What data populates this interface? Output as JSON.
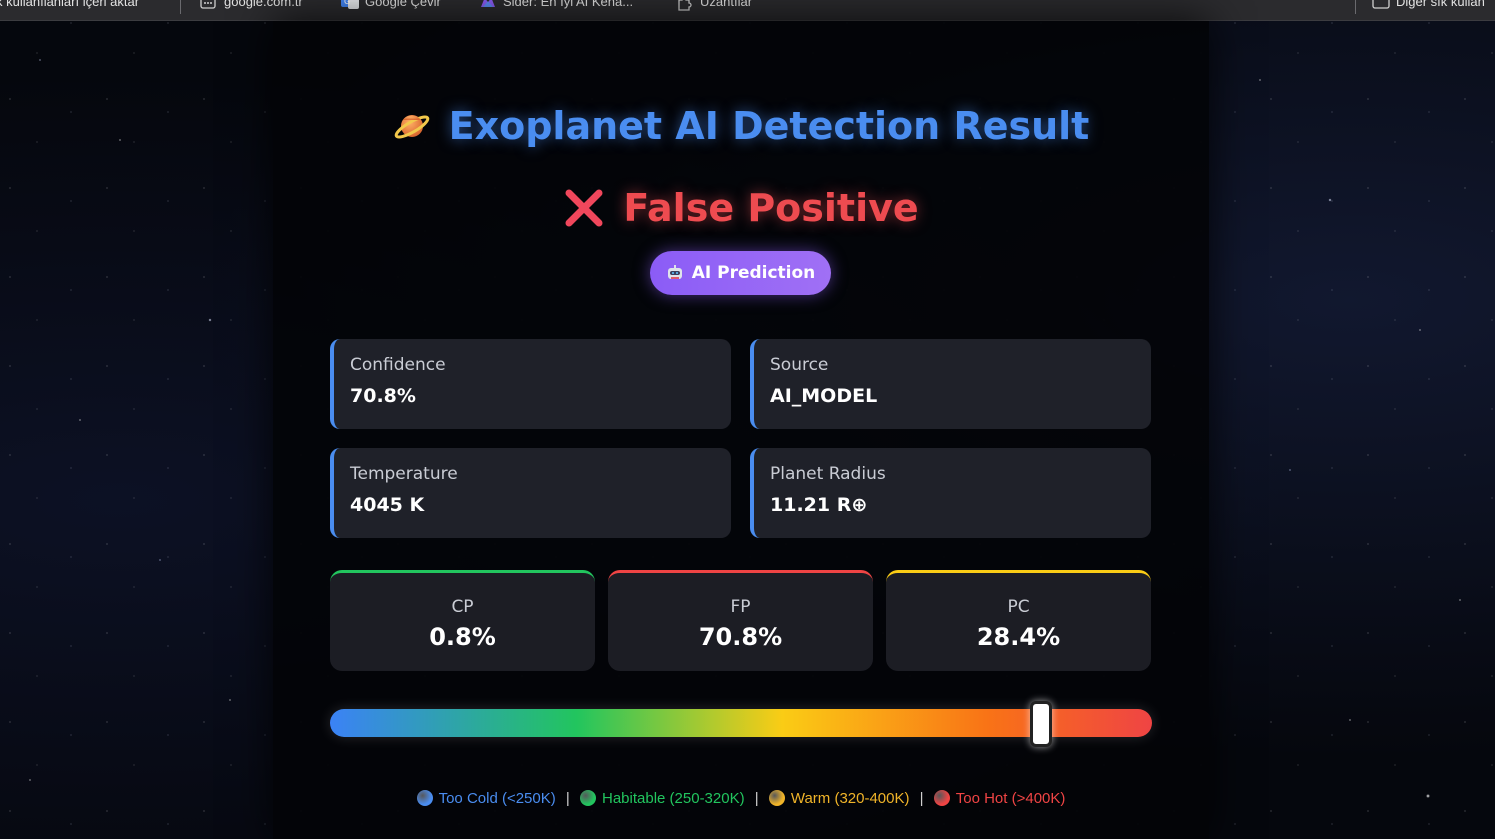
{
  "bookmarks_bar": {
    "items": [
      {
        "label": "k kullanılanları içeri aktar",
        "icon": "none"
      },
      {
        "label": "google.com.tr",
        "icon": "grid-icon"
      },
      {
        "label": "Google Çevir",
        "icon": "translate-icon"
      },
      {
        "label": "Sider: En İyi AI Kena...",
        "icon": "sider-icon"
      },
      {
        "label": "Uzantılar",
        "icon": "puzzle-icon"
      }
    ],
    "other_bookmarks": "Diğer sık kullan"
  },
  "header": {
    "title": "Exoplanet AI Detection Result",
    "result_label": "False Positive",
    "result_color": "#ee4b50",
    "title_color": "#4a8df0"
  },
  "badge": {
    "label": "AI Prediction"
  },
  "info_cards": [
    {
      "label": "Confidence",
      "value": "70.8%"
    },
    {
      "label": "Source",
      "value": "AI_MODEL"
    },
    {
      "label": "Temperature",
      "value": "4045 K"
    },
    {
      "label": "Planet Radius",
      "value": "11.21 R⊕"
    }
  ],
  "probabilities": [
    {
      "label": "CP",
      "value": "0.8%",
      "color": "#22c55e"
    },
    {
      "label": "FP",
      "value": "70.8%",
      "color": "#ef4444"
    },
    {
      "label": "PC",
      "value": "28.4%",
      "color": "#facc15"
    }
  ],
  "temperature_scale": {
    "marker_fraction": 0.865
  },
  "legend": [
    {
      "label": "Too Cold (<250K)",
      "color": "#4a8df0"
    },
    {
      "label": "Habitable (250-320K)",
      "color": "#22c55e"
    },
    {
      "label": "Warm (320-400K)",
      "color": "#f0b429"
    },
    {
      "label": "Too Hot (>400K)",
      "color": "#ef4444"
    }
  ]
}
